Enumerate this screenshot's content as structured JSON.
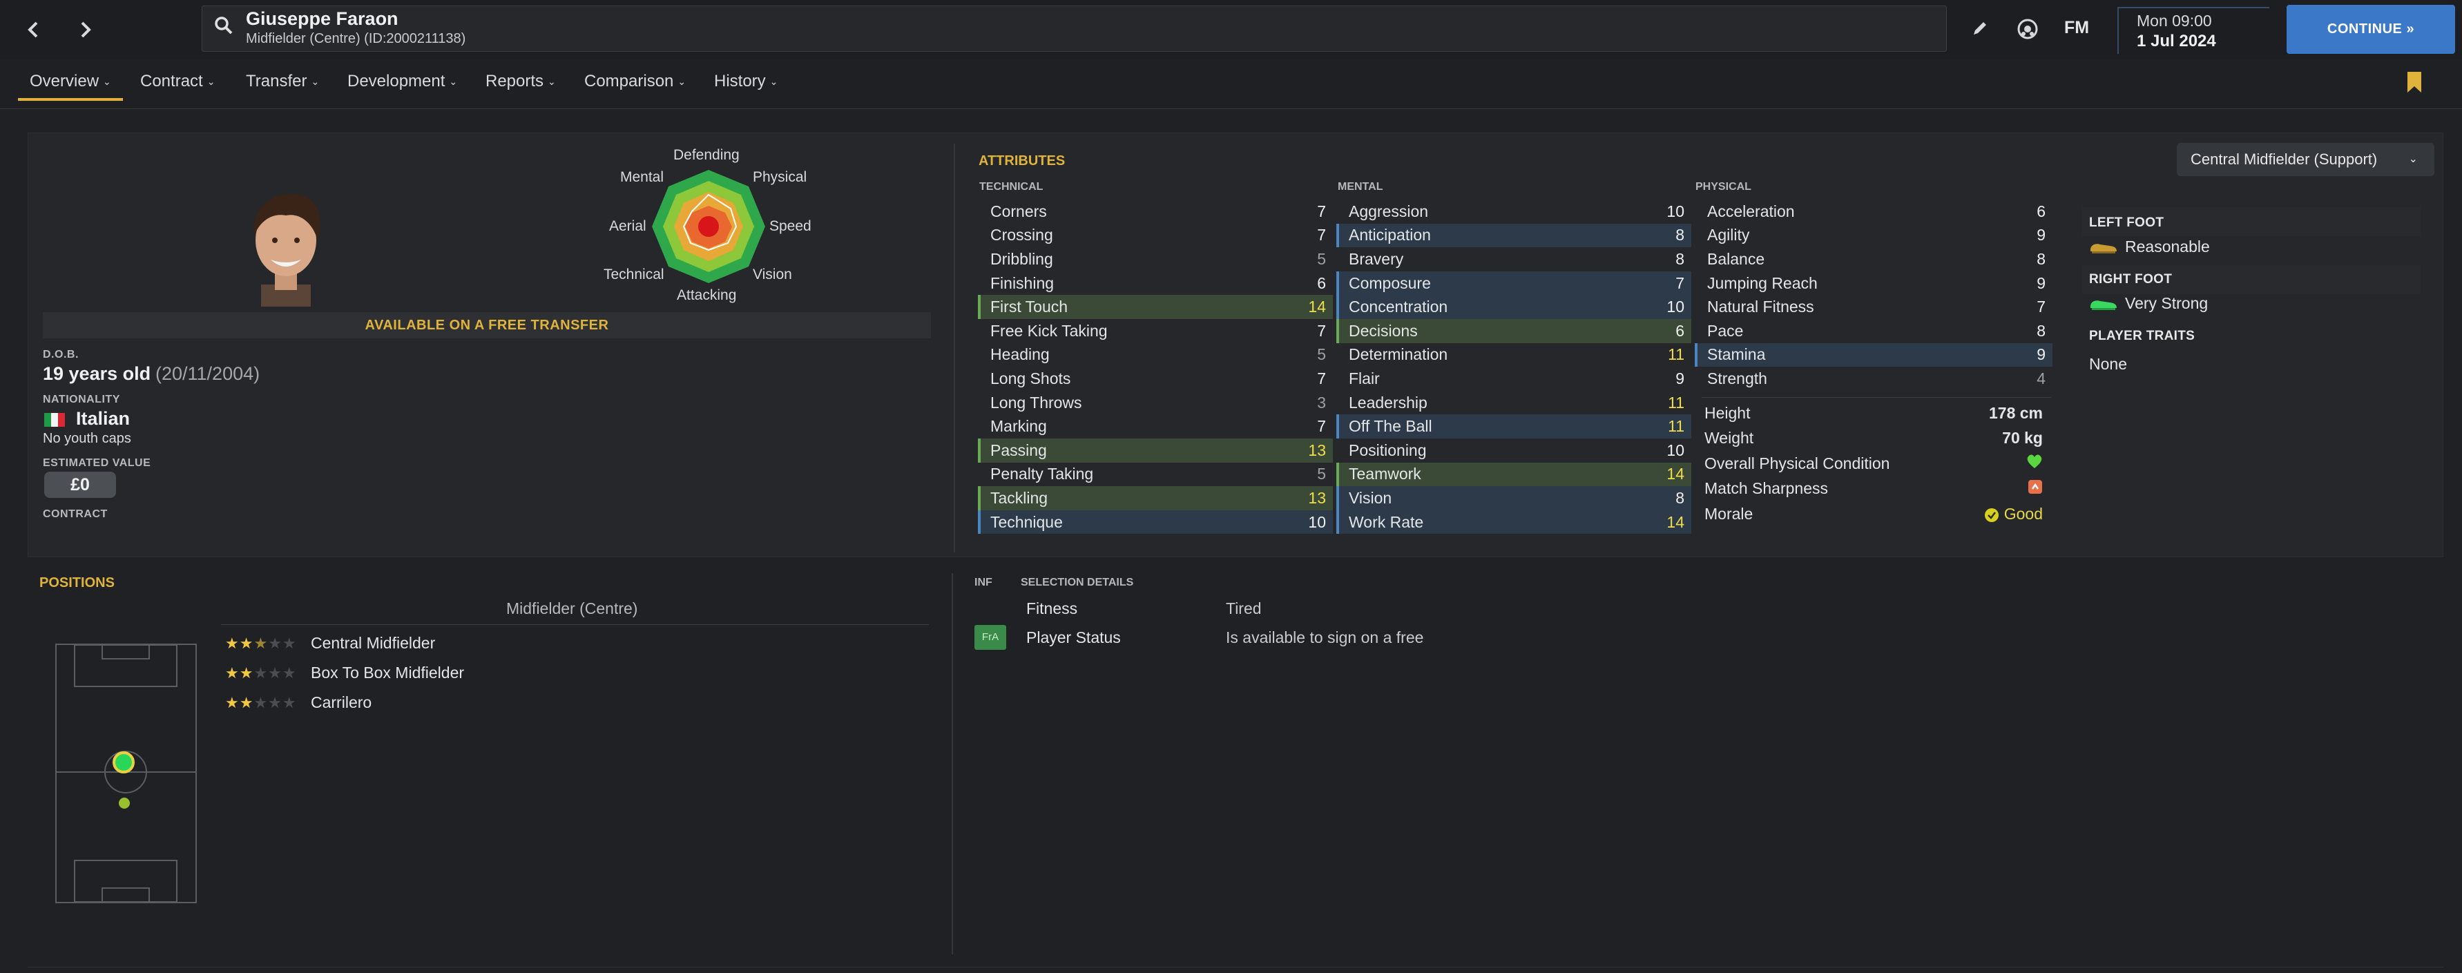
{
  "header": {
    "player_name": "Giuseppe Faraon",
    "player_subtitle": "Midfielder (Centre) (ID:2000211138)",
    "fm_logo": "FM",
    "time": "Mon 09:00",
    "date": "1 Jul 2024",
    "continue_label": "CONTINUE",
    "icons": [
      "back-arrow-icon",
      "forward-arrow-icon",
      "search-icon",
      "edit-icon",
      "football-icon",
      "bookmark-icon"
    ]
  },
  "tabs": [
    {
      "label": "Overview",
      "active": true
    },
    {
      "label": "Contract"
    },
    {
      "label": "Transfer"
    },
    {
      "label": "Development"
    },
    {
      "label": "Reports"
    },
    {
      "label": "Comparison"
    },
    {
      "label": "History"
    }
  ],
  "radar": {
    "labels": {
      "defending": "Defending",
      "physical": "Physical",
      "speed": "Speed",
      "vision": "Vision",
      "attacking": "Attacking",
      "technical": "Technical",
      "aerial": "Aerial",
      "mental": "Mental"
    }
  },
  "profile": {
    "free_transfer": "AVAILABLE ON A FREE TRANSFER",
    "dob_label": "D.O.B.",
    "age": "19 years old",
    "dob": "(20/11/2004)",
    "nationality_label": "NATIONALITY",
    "nationality": "Italian",
    "caps": "No youth caps",
    "value_label": "ESTIMATED VALUE",
    "value": "£0",
    "contract_label": "CONTRACT"
  },
  "attributes": {
    "title": "ATTRIBUTES",
    "role": "Central Midfielder (Support)",
    "technical_header": "TECHNICAL",
    "mental_header": "MENTAL",
    "physical_header": "PHYSICAL",
    "technical": [
      {
        "name": "Corners",
        "value": "7"
      },
      {
        "name": "Crossing",
        "value": "7"
      },
      {
        "name": "Dribbling",
        "value": "5"
      },
      {
        "name": "Finishing",
        "value": "6"
      },
      {
        "name": "First Touch",
        "value": "14"
      },
      {
        "name": "Free Kick Taking",
        "value": "7"
      },
      {
        "name": "Heading",
        "value": "5"
      },
      {
        "name": "Long Shots",
        "value": "7"
      },
      {
        "name": "Long Throws",
        "value": "3"
      },
      {
        "name": "Marking",
        "value": "7"
      },
      {
        "name": "Passing",
        "value": "13"
      },
      {
        "name": "Penalty Taking",
        "value": "5"
      },
      {
        "name": "Tackling",
        "value": "13"
      },
      {
        "name": "Technique",
        "value": "10"
      }
    ],
    "mental": [
      {
        "name": "Aggression",
        "value": "10"
      },
      {
        "name": "Anticipation",
        "value": "8"
      },
      {
        "name": "Bravery",
        "value": "8"
      },
      {
        "name": "Composure",
        "value": "7"
      },
      {
        "name": "Concentration",
        "value": "10"
      },
      {
        "name": "Decisions",
        "value": "6"
      },
      {
        "name": "Determination",
        "value": "11"
      },
      {
        "name": "Flair",
        "value": "9"
      },
      {
        "name": "Leadership",
        "value": "11"
      },
      {
        "name": "Off The Ball",
        "value": "11"
      },
      {
        "name": "Positioning",
        "value": "10"
      },
      {
        "name": "Teamwork",
        "value": "14"
      },
      {
        "name": "Vision",
        "value": "8"
      },
      {
        "name": "Work Rate",
        "value": "14"
      }
    ],
    "physical": [
      {
        "name": "Acceleration",
        "value": "6"
      },
      {
        "name": "Agility",
        "value": "9"
      },
      {
        "name": "Balance",
        "value": "8"
      },
      {
        "name": "Jumping Reach",
        "value": "9"
      },
      {
        "name": "Natural Fitness",
        "value": "7"
      },
      {
        "name": "Pace",
        "value": "8"
      },
      {
        "name": "Stamina",
        "value": "9"
      },
      {
        "name": "Strength",
        "value": "4"
      }
    ],
    "physical_info": {
      "height_label": "Height",
      "height": "178 cm",
      "weight_label": "Weight",
      "weight": "70 kg",
      "condition_label": "Overall Physical Condition",
      "sharpness_label": "Match Sharpness",
      "morale_label": "Morale",
      "morale": "Good"
    },
    "feet": {
      "left_label": "LEFT FOOT",
      "left": "Reasonable",
      "right_label": "RIGHT FOOT",
      "right": "Very Strong",
      "traits_label": "PLAYER TRAITS",
      "traits": "None"
    }
  },
  "positions": {
    "title": "POSITIONS",
    "role": "Midfielder (Centre)",
    "items": [
      {
        "name": "Central Midfielder",
        "stars": 2.5
      },
      {
        "name": "Box To Box Midfielder",
        "stars": 2
      },
      {
        "name": "Carrilero",
        "stars": 2
      }
    ]
  },
  "selection": {
    "inf_label": "INF",
    "title": "SELECTION DETAILS",
    "fitness_label": "Fitness",
    "fitness": "Tired",
    "badge": "FrA",
    "status_label": "Player Status",
    "status": "Is available to sign on a free"
  },
  "colors": {
    "accent": "#e0b43a",
    "continue": "#3c78c8",
    "highlight_green": "#3b4a36",
    "highlight_blue": "#2c3a4a",
    "stat_yellow": "#f1dd4a"
  }
}
